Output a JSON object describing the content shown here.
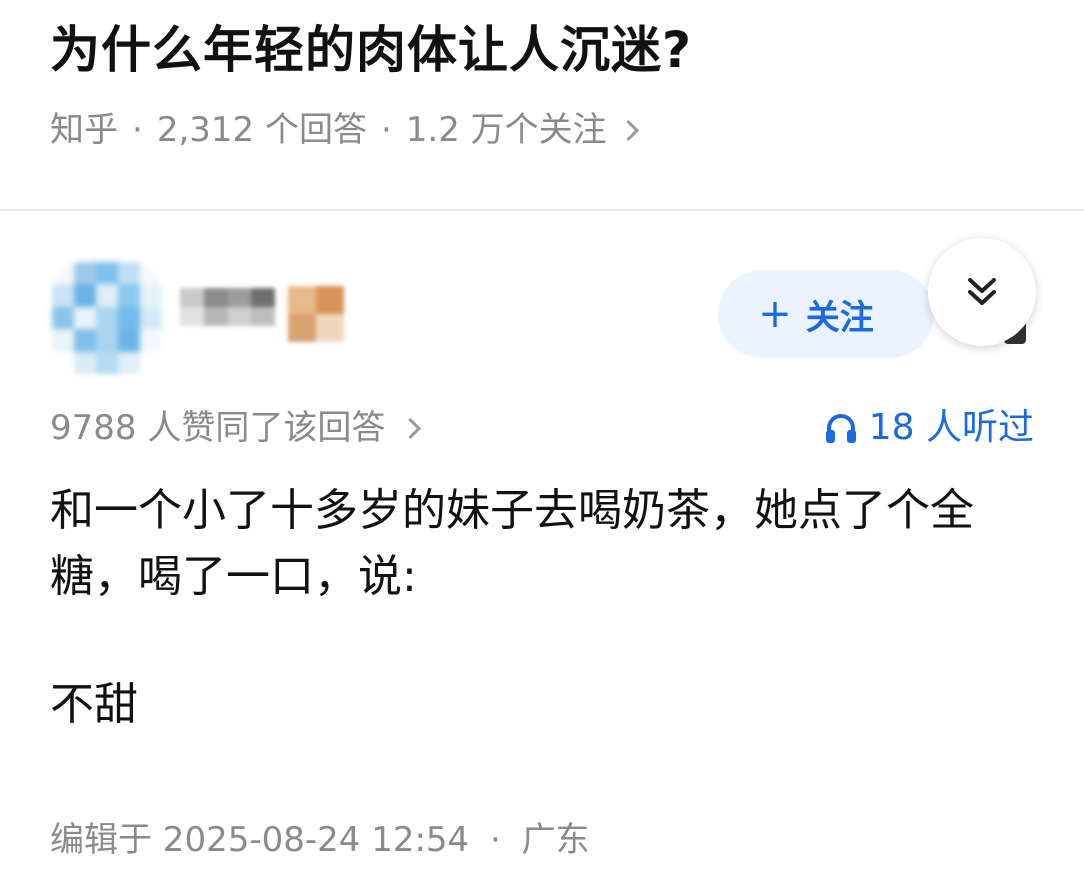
{
  "question": {
    "title": "为什么年轻的肉体让人沉迷?",
    "source": "知乎",
    "answers": "2,312 个回答",
    "followers": "1.2 万个关注",
    "separator": "·"
  },
  "author": {
    "follow_label": "关注",
    "follow_plus": "+"
  },
  "answer": {
    "votes": "9788 人赞同了该回答",
    "listens": "18 人听过",
    "body_line1": "和一个小了十多岁的妹子去喝奶茶，她点了个全糖，喝了一口，说:",
    "body_line2": "不甜",
    "edited": "编辑于 2025-08-24 12:54",
    "location": "广东",
    "separator": "·"
  },
  "colors": {
    "accent": "#1a6ae4",
    "muted_text": "#8a8a8a",
    "follow_bg": "#ebf3fe"
  },
  "icons": [
    "chevron-right-icon",
    "double-chevron-down-icon",
    "headphones-icon",
    "plus-icon"
  ]
}
